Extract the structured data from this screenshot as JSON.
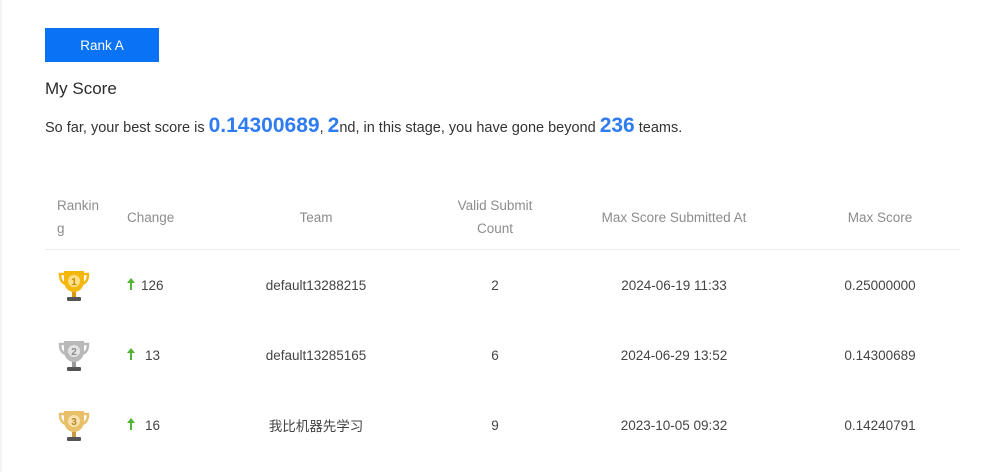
{
  "rank_button": "Rank A",
  "title": "My Score",
  "summary": {
    "prefix": "So far, your best score is ",
    "best_score": "0.14300689",
    "sep": ", ",
    "rank": "2",
    "rank_suffix": "nd, in this stage, you have gone beyond ",
    "teams_beyond": "236",
    "suffix": " teams."
  },
  "table": {
    "headers": {
      "ranking": "Ranking",
      "change": "Change",
      "team": "Team",
      "count": "Valid Submit Count",
      "date": "Max Score Submitted At",
      "score": "Max Score"
    },
    "rows": [
      {
        "medal": "gold-trophy-icon",
        "medal_number": "1",
        "change": "126",
        "team": "default13288215",
        "count": "2",
        "date": "2024-06-19 11:33",
        "score": "0.25000000"
      },
      {
        "medal": "silver-trophy-icon",
        "medal_number": "2",
        "change": "13",
        "team": "default13285165",
        "count": "6",
        "date": "2024-06-29 13:52",
        "score": "0.14300689"
      },
      {
        "medal": "bronze-trophy-icon",
        "medal_number": "3",
        "change": "16",
        "team": "我比机器先学习",
        "count": "9",
        "date": "2023-10-05 09:32",
        "score": "0.14240791"
      }
    ]
  },
  "colors": {
    "accent": "#0a73f5",
    "highlight": "#2f7cf2",
    "change_up": "#52b435",
    "gold": "#f5b70d",
    "silver": "#b9b9b9",
    "bronze": "#e8c06a"
  }
}
